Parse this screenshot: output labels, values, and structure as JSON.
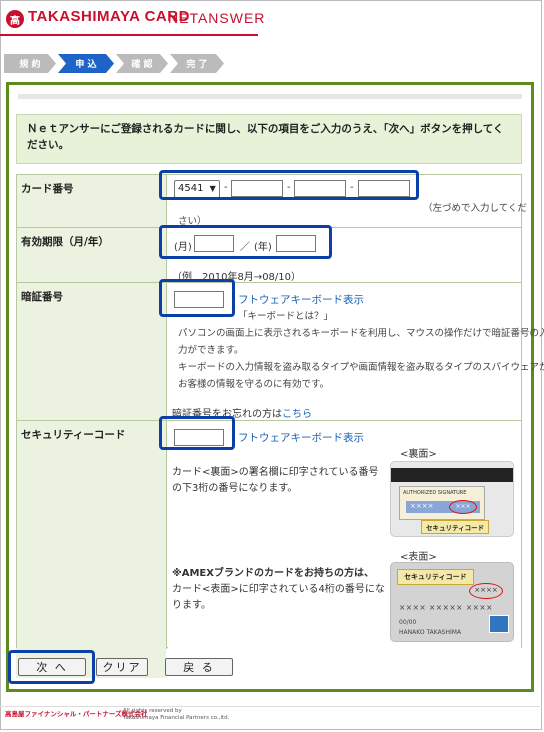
{
  "header": {
    "logo_mark": "高",
    "brand": "TAKASHIMAYA CARD",
    "service": "NETANSWER"
  },
  "steps": [
    {
      "label": "規 約",
      "color": "#bbbbbb"
    },
    {
      "label": "申 込",
      "color": "#1e64c8"
    },
    {
      "label": "確 認",
      "color": "#bbbbbb"
    },
    {
      "label": "完 了",
      "color": "#bbbbbb"
    }
  ],
  "intro": "Ｎｅｔアンサーにご登録されるカードに関し、以下の項目をご入力のうえ、「次へ」ボタンを押してください。",
  "card_number": {
    "label": "カード番号",
    "prefix": "4541",
    "separator": "-",
    "note": "（左づめで入力してくだ",
    "note2": "さい）"
  },
  "expiry": {
    "label": "有効期限（月/年）",
    "month_label": "(月)",
    "slash": "／",
    "year_label": "(年)",
    "example": "（例　2010年8月→08/10）"
  },
  "pin": {
    "label": "暗証番号",
    "keyboard_link": "フトウェアキーボード表示",
    "what_is": "「キーボードとは？」",
    "desc1": "パソコンの画面上に表示されるキーボードを利用し、マウスの操作だけで暗証番号の入",
    "desc2": "力ができます。",
    "desc3": "キーボードの入力情報を盗み取るタイプや画面情報を盗み取るタイプのスパイウェアから",
    "desc4": "お客様の情報を守るのに有効です。",
    "forgot_prefix": "暗証番号をお忘れの方は",
    "forgot_link": "こちら"
  },
  "security": {
    "label": "セキュリティーコード",
    "keyboard_link": "フトウェアキーボード表示",
    "back_label": "<裏面>",
    "back_text1": "カード<裏面>の署名欄に印字されている番号",
    "back_text2": "の下3桁の番号になります。",
    "signature": "AUTHORIZED SIGNATURE",
    "back_mask": "××××",
    "back_code": "×××",
    "back_tag": "セキュリティコード",
    "front_label": "<表面>",
    "amex1": "※AMEXブランドのカードをお持ちの方は、",
    "amex2": "カード<表面>に印字されている4桁の番号にな",
    "amex3": "ります。",
    "front_tag": "セキュリティコード",
    "front_code": "××××",
    "front_number": "×××× ××××× ××××",
    "front_expiry": "00/00",
    "front_name": "HANAKO TAKASHIMA"
  },
  "buttons": {
    "next": "次 へ",
    "clear": "クリア",
    "back": "戻 る"
  },
  "footer": {
    "company": "高島屋ファイナンシャル・パートナーズ株式会社",
    "rights1": "All rights reserved by",
    "rights2": "Takashimaya Financial Partners co.,ltd."
  },
  "colors": {
    "brand_red": "#c8102e",
    "panel_green": "#5d8c1c",
    "highlight_blue": "#0c3fa8",
    "active_step": "#1e64c8"
  }
}
